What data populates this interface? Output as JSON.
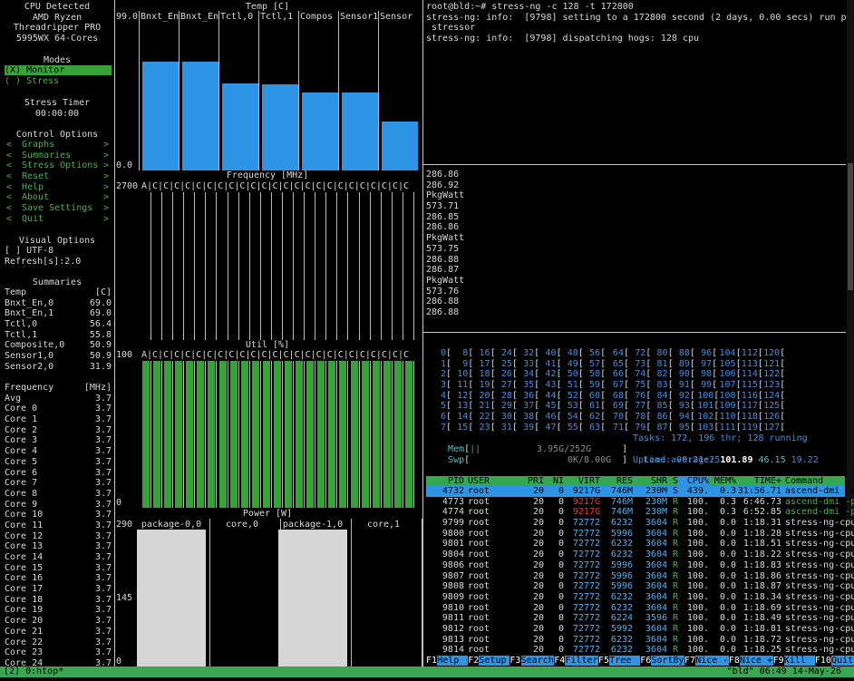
{
  "sidebar": {
    "cpu_detected": [
      "CPU Detected",
      "AMD Ryzen",
      "Threadripper PRO",
      "5995WX 64-Cores"
    ],
    "modes_title": "Modes",
    "modes": [
      "(X) Monitor",
      "( ) Stress"
    ],
    "stress_timer_title": "Stress Timer",
    "stress_timer_value": "00:00:00",
    "control_title": "Control Options",
    "controls": [
      {
        "label": "Graphs"
      },
      {
        "label": "Summaries"
      },
      {
        "label": "Stress Options"
      },
      {
        "label": "Reset"
      },
      {
        "label": "Help"
      },
      {
        "label": "About"
      },
      {
        "label": "Save Settings"
      },
      {
        "label": "Quit"
      }
    ],
    "visual_title": "Visual Options",
    "utf8_label": "[ ] UTF-8",
    "refresh_label": "Refresh[s]:2.0",
    "summaries_title": "Summaries",
    "temp_header": [
      "Temp",
      "[C]"
    ],
    "temp_rows": [
      [
        "Bnxt_En,0",
        "69.0"
      ],
      [
        "Bnxt_En,1",
        "69.0"
      ],
      [
        "Tctl,0",
        "56.4"
      ],
      [
        "Tctl,1",
        "55.8"
      ],
      [
        "Composite,0",
        "50.9"
      ],
      [
        "Sensor1,0",
        "50.9"
      ],
      [
        "Sensor2,0",
        "31.9"
      ]
    ],
    "freq_header": [
      "Frequency",
      "[MHz]"
    ],
    "freq_rows": [
      [
        "Avg",
        "3.7"
      ],
      [
        "Core 0",
        "3.7"
      ],
      [
        "Core 1",
        "3.7"
      ],
      [
        "Core 2",
        "3.7"
      ],
      [
        "Core 3",
        "3.7"
      ],
      [
        "Core 4",
        "3.7"
      ],
      [
        "Core 5",
        "3.7"
      ],
      [
        "Core 6",
        "3.7"
      ],
      [
        "Core 7",
        "3.7"
      ],
      [
        "Core 8",
        "3.7"
      ],
      [
        "Core 9",
        "3.7"
      ],
      [
        "Core 10",
        "3.7"
      ],
      [
        "Core 11",
        "3.7"
      ],
      [
        "Core 12",
        "3.7"
      ],
      [
        "Core 13",
        "3.7"
      ],
      [
        "Core 14",
        "3.7"
      ],
      [
        "Core 15",
        "3.7"
      ],
      [
        "Core 16",
        "3.7"
      ],
      [
        "Core 17",
        "3.7"
      ],
      [
        "Core 18",
        "3.7"
      ],
      [
        "Core 19",
        "3.7"
      ],
      [
        "Core 20",
        "3.7"
      ],
      [
        "Core 21",
        "3.7"
      ],
      [
        "Core 22",
        "3.7"
      ],
      [
        "Core 23",
        "3.7"
      ],
      [
        "Core 24",
        "3.7"
      ]
    ]
  },
  "graphs": {
    "temp_title": "Temp [C]",
    "temp_max": "99.0",
    "temp_min": "0.0",
    "temp_cols": [
      "Bnxt_En",
      "Bnxt_En",
      "Tctl,0",
      "Tctl,1",
      "Compos",
      "Sensor1",
      "Sensor"
    ],
    "temp_levels": [
      0.71,
      0.71,
      0.57,
      0.56,
      0.51,
      0.51,
      0.32
    ],
    "freq_title": "Frequency [MHz]",
    "freq_max": "2700",
    "freq_marks": "A|C|C|C|C|C|C|C|C|C|C|C|C|C|C|C|C|C|C|C|C|C|C|C|C",
    "util_title": "Util [%]",
    "util_max": "100",
    "util_min": "0",
    "util_marks": "A|C|C|C|C|C|C|C|C|C|C|C|C|C|C|C|C|C|C|C|C|C|C|C|C",
    "power_title": "Power [W]",
    "power_max": "290",
    "power_mid": "145",
    "power_min": "0",
    "power_cols": [
      "package-0,0",
      "core,0",
      "package-1,0",
      "core,1"
    ]
  },
  "terminal": {
    "lines": [
      "root@bld:~# stress-ng -c 128 -t 172800",
      "stress-ng: info:  [9798] setting to a 172800 second (2 days, 0.00 secs) run per",
      " stressor",
      "stress-ng: info:  [9798] dispatching hogs: 128 cpu"
    ]
  },
  "power_log": {
    "lines": [
      "286.86",
      "286.92",
      "PkgWatt",
      "573.71",
      "286.85",
      "286.86",
      "PkgWatt",
      "573.75",
      "286.88",
      "286.87",
      "PkgWatt",
      "573.76",
      "286.88",
      "286.88"
    ]
  },
  "htop": {
    "cpu_grid": [
      [
        [
          "0",
          "8",
          "16",
          "24",
          "32",
          "40",
          "48",
          "56"
        ],
        [
          "64",
          "72",
          "80",
          "88",
          "96",
          "104",
          "112",
          "120"
        ]
      ],
      [
        [
          "1",
          "9",
          "17",
          "25",
          "33",
          "41",
          "49",
          "57"
        ],
        [
          "65",
          "73",
          "81",
          "89",
          "97",
          "105",
          "113",
          "121"
        ]
      ],
      [
        [
          "2",
          "10",
          "18",
          "26",
          "34",
          "42",
          "50",
          "58"
        ],
        [
          "66",
          "74",
          "82",
          "90",
          "98",
          "106",
          "114",
          "122"
        ]
      ],
      [
        [
          "3",
          "11",
          "19",
          "27",
          "35",
          "43",
          "51",
          "59"
        ],
        [
          "67",
          "75",
          "83",
          "91",
          "99",
          "107",
          "115",
          "123"
        ]
      ],
      [
        [
          "4",
          "12",
          "20",
          "28",
          "36",
          "44",
          "52",
          "60"
        ],
        [
          "68",
          "76",
          "84",
          "92",
          "100",
          "108",
          "116",
          "124"
        ]
      ],
      [
        [
          "5",
          "13",
          "21",
          "29",
          "37",
          "45",
          "53",
          "61"
        ],
        [
          "69",
          "77",
          "85",
          "93",
          "101",
          "109",
          "117",
          "125"
        ]
      ],
      [
        [
          "6",
          "14",
          "22",
          "30",
          "38",
          "46",
          "54",
          "62"
        ],
        [
          "70",
          "78",
          "86",
          "94",
          "102",
          "110",
          "118",
          "126"
        ]
      ],
      [
        [
          "7",
          "15",
          "23",
          "31",
          "39",
          "47",
          "55",
          "63"
        ],
        [
          "71",
          "79",
          "87",
          "95",
          "103",
          "111",
          "119",
          "127"
        ]
      ]
    ],
    "mem_label": "Mem",
    "mem_value": "3.95G/252G",
    "swp_label": "Swp",
    "swp_value": "0K/8.00G",
    "tasks": "Tasks: 172, 196 thr; 128 running",
    "load_label": "Load average: ",
    "load_values": [
      "101.89",
      "46.15",
      "19.22"
    ],
    "uptime": "Uptime: 00:21:25",
    "header": [
      "PID",
      "USER",
      "PRI",
      "NI",
      "VIRT",
      "RES",
      "SHR",
      "S",
      "CPU%",
      "MEM%",
      "TIME+",
      "Command"
    ],
    "processes": [
      [
        "4732",
        "root",
        "20",
        "0",
        "9217G",
        "746M",
        "230M",
        "S",
        "439.",
        "0.3",
        "31:56.71",
        "ascend-dmi -p"
      ],
      [
        "4773",
        "root",
        "20",
        "0",
        "9217G",
        "746M",
        "230M",
        "R",
        "100.",
        "0.3",
        "6:46.73",
        "ascend-dmi -p"
      ],
      [
        "4774",
        "root",
        "20",
        "0",
        "9217G",
        "746M",
        "230M",
        "R",
        "100.",
        "0.3",
        "6:52.85",
        "ascend-dmi -p"
      ],
      [
        "9799",
        "root",
        "20",
        "0",
        "72772",
        "6232",
        "3604",
        "R",
        "100.",
        "0.0",
        "1:18.31",
        "stress-ng-cpu"
      ],
      [
        "9800",
        "root",
        "20",
        "0",
        "72772",
        "5996",
        "3604",
        "R",
        "100.",
        "0.0",
        "1:18.28",
        "stress-ng-cpu"
      ],
      [
        "9801",
        "root",
        "20",
        "0",
        "72772",
        "6232",
        "3604",
        "R",
        "100.",
        "0.0",
        "1:18.51",
        "stress-ng-cpu"
      ],
      [
        "9804",
        "root",
        "20",
        "0",
        "72772",
        "6232",
        "3604",
        "R",
        "100.",
        "0.0",
        "1:18.22",
        "stress-ng-cpu"
      ],
      [
        "9806",
        "root",
        "20",
        "0",
        "72772",
        "5996",
        "3604",
        "R",
        "100.",
        "0.0",
        "1:18.83",
        "stress-ng-cpu"
      ],
      [
        "9807",
        "root",
        "20",
        "0",
        "72772",
        "5996",
        "3604",
        "R",
        "100.",
        "0.0",
        "1:18.86",
        "stress-ng-cpu"
      ],
      [
        "9808",
        "root",
        "20",
        "0",
        "72772",
        "5996",
        "3604",
        "R",
        "100.",
        "0.0",
        "1:18.87",
        "stress-ng-cpu"
      ],
      [
        "9809",
        "root",
        "20",
        "0",
        "72772",
        "6232",
        "3604",
        "R",
        "100.",
        "0.0",
        "1:18.34",
        "stress-ng-cpu"
      ],
      [
        "9810",
        "root",
        "20",
        "0",
        "72772",
        "6232",
        "3604",
        "R",
        "100.",
        "0.0",
        "1:18.69",
        "stress-ng-cpu"
      ],
      [
        "9811",
        "root",
        "20",
        "0",
        "72772",
        "6224",
        "3596",
        "R",
        "100.",
        "0.0",
        "1:18.49",
        "stress-ng-cpu"
      ],
      [
        "9812",
        "root",
        "20",
        "0",
        "72772",
        "5992",
        "3604",
        "R",
        "100.",
        "0.0",
        "1:18.81",
        "stress-ng-cpu"
      ],
      [
        "9813",
        "root",
        "20",
        "0",
        "72772",
        "6232",
        "3604",
        "R",
        "100.",
        "0.0",
        "1:18.72",
        "stress-ng-cpu"
      ],
      [
        "9814",
        "root",
        "20",
        "0",
        "72772",
        "6232",
        "3604",
        "R",
        "100.",
        "0.0",
        "1:18.25",
        "stress-ng-cpu"
      ]
    ],
    "fkeys": [
      [
        "F1",
        "Help"
      ],
      [
        "F2",
        "Setup"
      ],
      [
        "F3",
        "Search"
      ],
      [
        "F4",
        "Filter"
      ],
      [
        "F5",
        "Tree"
      ],
      [
        "F6",
        "SortBy"
      ],
      [
        "F7",
        "Nice -"
      ],
      [
        "F8",
        "Nice +"
      ],
      [
        "F9",
        "Kill"
      ],
      [
        "F10",
        "Quit"
      ]
    ]
  },
  "statusbar": {
    "left": "[2] 0:htop*",
    "right": "\"bld\" 06:49 14-May-26"
  },
  "colors": {
    "accent_blue": "#2e95e6",
    "util_green": "#37a237",
    "tmux_green": "#3aa64f",
    "header_green": "#33a84e"
  }
}
